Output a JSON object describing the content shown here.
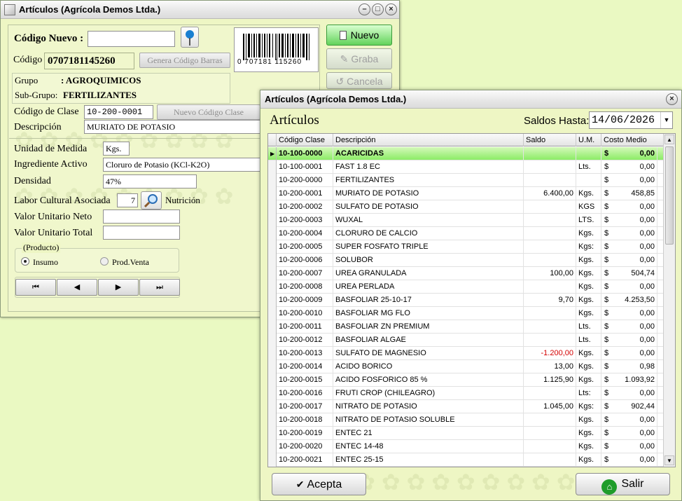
{
  "back_window": {
    "title": "Artículos (Agrícola Demos Ltda.)",
    "controls": {
      "minimize": "–",
      "maximize": "□",
      "close": "×"
    },
    "codigo_nuevo_label": "Código Nuevo :",
    "codigo_nuevo_value": "",
    "codigo_label": "Código",
    "codigo_value": "0707181145260",
    "genera_codigo_barras": "Genera Código Barras",
    "barcode_text": "0 707181 115260",
    "grupo_label": "Grupo",
    "grupo_value": ": AGROQUIMICOS",
    "subgrupo_label": "Sub-Grupo:",
    "subgrupo_value": "FERTILIZANTES",
    "codigo_clase_label": "Código de Clase",
    "codigo_clase_value": "10-200-0001",
    "nuevo_codigo_clase": "Nuevo Código Clase",
    "descripcion_label": "Descripción",
    "descripcion_value": "MURIATO DE POTASIO",
    "unidad_label": "Unidad de Medida",
    "unidad_value": "Kgs.",
    "ingrediente_label": "Ingrediente Activo",
    "ingrediente_value": "Cloruro de Potasio (KCl-K2O)",
    "densidad_label": "Densidad",
    "densidad_value": "47%",
    "labor_label": "Labor Cultural Asociada",
    "labor_value": "7",
    "labor_desc": "Nutrición",
    "valor_neto_label": "Valor Unitario Neto",
    "valor_neto_value": "",
    "valor_total_label": "Valor Unitario Total",
    "valor_total_value": "",
    "producto_label": "(Producto)",
    "radio_insumo": "Insumo",
    "radio_prodventa": "Prod.Venta",
    "btn_nuevo": "Nuevo",
    "btn_graba": "Graba",
    "btn_cancela": "Cancela",
    "nav": {
      "first": "⏮",
      "prev": "◀",
      "next": "▶",
      "last": "⏭"
    }
  },
  "front_window": {
    "title": "Artículos (Agrícola Demos Ltda.)",
    "close": "×",
    "heading": "Artículos",
    "saldos_label": "Saldos Hasta:",
    "saldos_date": "14/06/2026",
    "columns": [
      "Código Clase",
      "Descripción",
      "Saldo",
      "U.M.",
      "Costo Medio"
    ],
    "rows": [
      {
        "code": "10-100-0000",
        "desc": "ACARICIDAS",
        "saldo": "",
        "um": "",
        "costo": "0,00",
        "selected": true
      },
      {
        "code": "10-100-0001",
        "desc": "FAST 1.8 EC",
        "saldo": "",
        "um": "Lts.",
        "costo": "0,00"
      },
      {
        "code": "10-200-0000",
        "desc": "FERTILIZANTES",
        "saldo": "",
        "um": "",
        "costo": "0,00"
      },
      {
        "code": "10-200-0001",
        "desc": "MURIATO DE POTASIO",
        "saldo": "6.400,00",
        "um": "Kgs.",
        "costo": "458,85"
      },
      {
        "code": "10-200-0002",
        "desc": "SULFATO DE POTASIO",
        "saldo": "",
        "um": "KGS",
        "costo": "0,00"
      },
      {
        "code": "10-200-0003",
        "desc": "WUXAL",
        "saldo": "",
        "um": "LTS.",
        "costo": "0,00"
      },
      {
        "code": "10-200-0004",
        "desc": "CLORURO DE CALCIO",
        "saldo": "",
        "um": "Kgs.",
        "costo": "0,00"
      },
      {
        "code": "10-200-0005",
        "desc": "SUPER FOSFATO TRIPLE",
        "saldo": "",
        "um": "Kgs:",
        "costo": "0,00"
      },
      {
        "code": "10-200-0006",
        "desc": "SOLUBOR",
        "saldo": "",
        "um": "Kgs.",
        "costo": "0,00"
      },
      {
        "code": "10-200-0007",
        "desc": "UREA GRANULADA",
        "saldo": "100,00",
        "um": "Kgs.",
        "costo": "504,74"
      },
      {
        "code": "10-200-0008",
        "desc": "UREA PERLADA",
        "saldo": "",
        "um": "Kgs.",
        "costo": "0,00"
      },
      {
        "code": "10-200-0009",
        "desc": "BASFOLIAR 25-10-17",
        "saldo": "9,70",
        "um": "Kgs.",
        "costo": "4.253,50"
      },
      {
        "code": "10-200-0010",
        "desc": "BASFOLIAR MG FLO",
        "saldo": "",
        "um": "Kgs.",
        "costo": "0,00"
      },
      {
        "code": "10-200-0011",
        "desc": "BASFOLIAR ZN PREMIUM",
        "saldo": "",
        "um": "Lts.",
        "costo": "0,00"
      },
      {
        "code": "10-200-0012",
        "desc": "BASFOLIAR ALGAE",
        "saldo": "",
        "um": "Lts.",
        "costo": "0,00"
      },
      {
        "code": "10-200-0013",
        "desc": "SULFATO DE MAGNESIO",
        "saldo": "-1.200,00",
        "um": "Kgs.",
        "costo": "0,00",
        "negative": true
      },
      {
        "code": "10-200-0014",
        "desc": "ACIDO BORICO",
        "saldo": "13,00",
        "um": "Kgs.",
        "costo": "0,98"
      },
      {
        "code": "10-200-0015",
        "desc": "ACIDO FOSFORICO 85 %",
        "saldo": "1.125,90",
        "um": "Kgs.",
        "costo": "1.093,92"
      },
      {
        "code": "10-200-0016",
        "desc": "FRUTI CROP (CHILEAGRO)",
        "saldo": "",
        "um": "Lts:",
        "costo": "0,00"
      },
      {
        "code": "10-200-0017",
        "desc": "NITRATO DE POTASIO",
        "saldo": "1.045,00",
        "um": "Kgs:",
        "costo": "902,44"
      },
      {
        "code": "10-200-0018",
        "desc": "NITRATO DE POTASIO SOLUBLE",
        "saldo": "",
        "um": "Kgs.",
        "costo": "0,00"
      },
      {
        "code": "10-200-0019",
        "desc": "ENTEC 21",
        "saldo": "",
        "um": "Kgs.",
        "costo": "0,00"
      },
      {
        "code": "10-200-0020",
        "desc": "ENTEC 14-48",
        "saldo": "",
        "um": "Kgs.",
        "costo": "0,00"
      },
      {
        "code": "10-200-0021",
        "desc": "ENTEC 25-15",
        "saldo": "",
        "um": "Kgs.",
        "costo": "0,00"
      }
    ],
    "currency": "$",
    "btn_acepta": "Acepta",
    "btn_salir": "Salir"
  }
}
